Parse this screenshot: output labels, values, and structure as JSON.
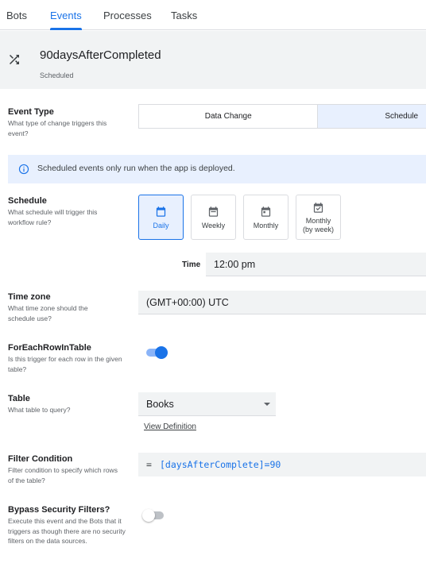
{
  "tabs": [
    {
      "label": "Bots"
    },
    {
      "label": "Events"
    },
    {
      "label": "Processes"
    },
    {
      "label": "Tasks"
    }
  ],
  "header": {
    "icon": "shuffle-icon",
    "title": "90daysAfterCompleted",
    "subtitle": "Scheduled"
  },
  "event_type": {
    "title": "Event Type",
    "description": "What type of change triggers this event?",
    "options": [
      "Data Change",
      "Schedule"
    ],
    "selected": "Schedule"
  },
  "info_banner": {
    "icon": "info-icon",
    "text": "Scheduled events only run when the app is deployed."
  },
  "schedule": {
    "title": "Schedule",
    "description": "What schedule will trigger this workflow rule?",
    "options": [
      {
        "label": "Daily",
        "icon": "calendar-today-icon"
      },
      {
        "label": "Weekly",
        "icon": "calendar-week-icon"
      },
      {
        "label": "Monthly",
        "icon": "calendar-month-icon"
      },
      {
        "label_line1": "Monthly",
        "label_line2": "(by week)",
        "icon": "calendar-check-icon"
      }
    ],
    "selected": "Daily"
  },
  "time": {
    "label": "Time",
    "value": "12:00 pm"
  },
  "time_zone": {
    "title": "Time zone",
    "description": "What time zone should the schedule use?",
    "value": "(GMT+00:00) UTC"
  },
  "for_each_row": {
    "title": "ForEachRowInTable",
    "description": "Is this trigger for each row in the given table?",
    "enabled": true
  },
  "table": {
    "title": "Table",
    "description": "What table to query?",
    "value": "Books",
    "link": "View Definition"
  },
  "filter_condition": {
    "title": "Filter Condition",
    "description": "Filter condition to specify which rows of the table?",
    "operator": "=",
    "expression": "[daysAfterComplete]=90"
  },
  "bypass_security": {
    "title": "Bypass Security Filters?",
    "description": "Execute this event and the Bots that it triggers as though there are no security filters on the data sources.",
    "enabled": false
  },
  "colors": {
    "accent": "#1a73e8",
    "selected_bg": "#e8f0fe",
    "header_bg": "#f1f3f4",
    "expression": "#1a73e8"
  }
}
